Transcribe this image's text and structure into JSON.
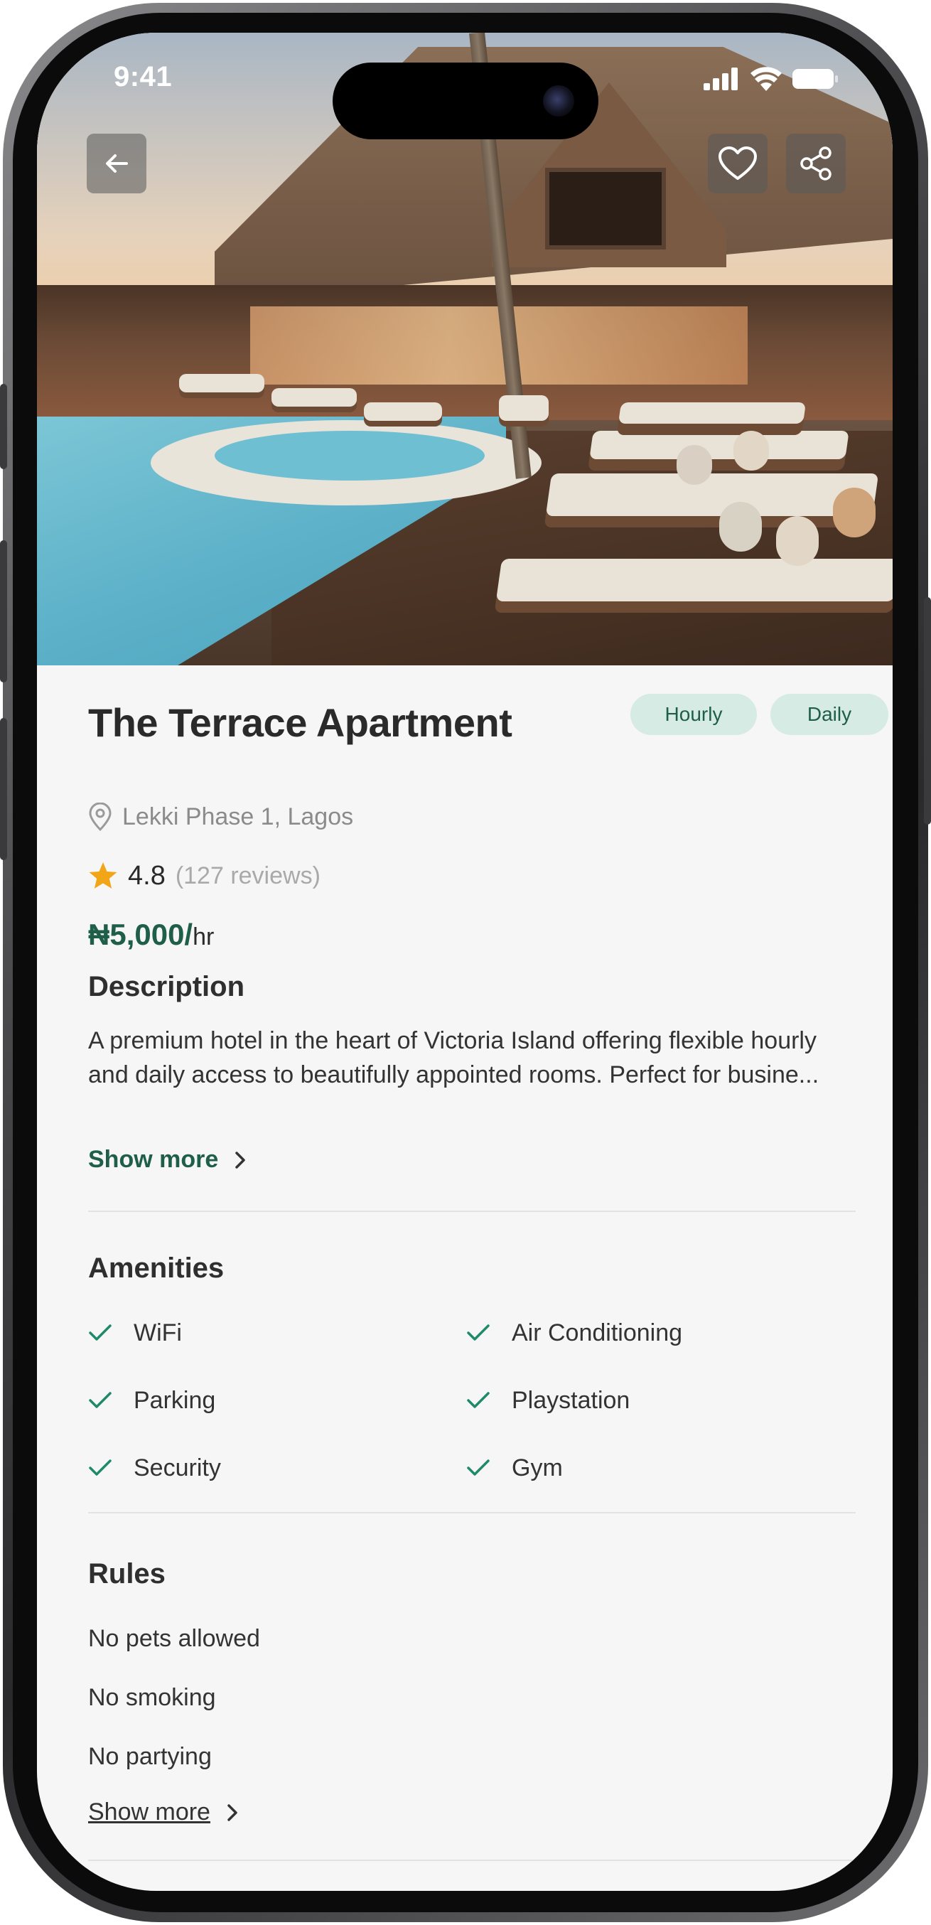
{
  "status_bar": {
    "time": "9:41"
  },
  "header": {
    "back_icon": "arrow-left-icon",
    "favorite_icon": "heart-icon",
    "share_icon": "share-icon"
  },
  "property": {
    "title": "The Terrace Apartment",
    "tags": [
      "Hourly",
      "Daily"
    ],
    "location": "Lekki Phase 1, Lagos",
    "rating": "4.8",
    "reviews": "(127 reviews)",
    "price": "₦5,000/",
    "price_unit": "hr"
  },
  "description": {
    "title": "Description",
    "text": "A premium hotel in the heart of Victoria Island offering flexible hourly and daily access to beautifully appointed rooms. Perfect for busine...",
    "show_more": "Show more"
  },
  "amenities": {
    "title": "Amenities",
    "items": [
      "WiFi",
      "Air Conditioning",
      "Parking",
      "Playstation",
      "Security",
      "Gym"
    ]
  },
  "rules": {
    "title": "Rules",
    "items": [
      "No pets allowed",
      "No smoking",
      "No partying"
    ],
    "show_more": "Show more"
  },
  "colors": {
    "brand_green": "#1f5e49",
    "tag_bg": "#d6ebe3",
    "star": "#f2a516"
  }
}
